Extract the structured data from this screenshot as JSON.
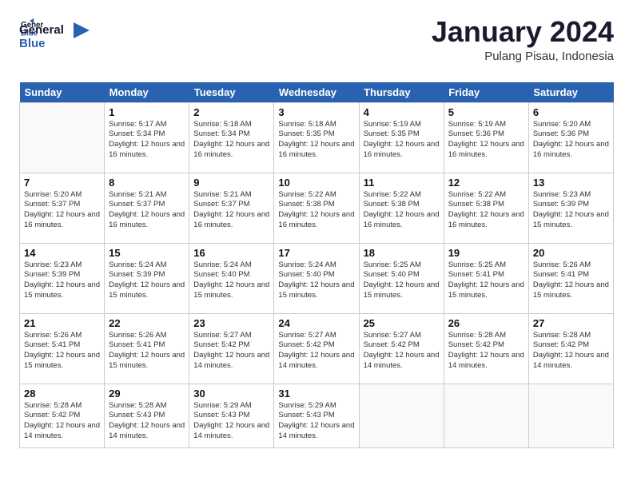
{
  "logo": {
    "line1": "General",
    "line2": "Blue"
  },
  "title": "January 2024",
  "subtitle": "Pulang Pisau, Indonesia",
  "days_header": [
    "Sunday",
    "Monday",
    "Tuesday",
    "Wednesday",
    "Thursday",
    "Friday",
    "Saturday"
  ],
  "weeks": [
    [
      {
        "day": "",
        "info": ""
      },
      {
        "day": "1",
        "info": "Sunrise: 5:17 AM\nSunset: 5:34 PM\nDaylight: 12 hours and 16 minutes."
      },
      {
        "day": "2",
        "info": "Sunrise: 5:18 AM\nSunset: 5:34 PM\nDaylight: 12 hours and 16 minutes."
      },
      {
        "day": "3",
        "info": "Sunrise: 5:18 AM\nSunset: 5:35 PM\nDaylight: 12 hours and 16 minutes."
      },
      {
        "day": "4",
        "info": "Sunrise: 5:19 AM\nSunset: 5:35 PM\nDaylight: 12 hours and 16 minutes."
      },
      {
        "day": "5",
        "info": "Sunrise: 5:19 AM\nSunset: 5:36 PM\nDaylight: 12 hours and 16 minutes."
      },
      {
        "day": "6",
        "info": "Sunrise: 5:20 AM\nSunset: 5:36 PM\nDaylight: 12 hours and 16 minutes."
      }
    ],
    [
      {
        "day": "7",
        "info": "Sunrise: 5:20 AM\nSunset: 5:37 PM\nDaylight: 12 hours and 16 minutes."
      },
      {
        "day": "8",
        "info": "Sunrise: 5:21 AM\nSunset: 5:37 PM\nDaylight: 12 hours and 16 minutes."
      },
      {
        "day": "9",
        "info": "Sunrise: 5:21 AM\nSunset: 5:37 PM\nDaylight: 12 hours and 16 minutes."
      },
      {
        "day": "10",
        "info": "Sunrise: 5:22 AM\nSunset: 5:38 PM\nDaylight: 12 hours and 16 minutes."
      },
      {
        "day": "11",
        "info": "Sunrise: 5:22 AM\nSunset: 5:38 PM\nDaylight: 12 hours and 16 minutes."
      },
      {
        "day": "12",
        "info": "Sunrise: 5:22 AM\nSunset: 5:38 PM\nDaylight: 12 hours and 16 minutes."
      },
      {
        "day": "13",
        "info": "Sunrise: 5:23 AM\nSunset: 5:39 PM\nDaylight: 12 hours and 15 minutes."
      }
    ],
    [
      {
        "day": "14",
        "info": "Sunrise: 5:23 AM\nSunset: 5:39 PM\nDaylight: 12 hours and 15 minutes."
      },
      {
        "day": "15",
        "info": "Sunrise: 5:24 AM\nSunset: 5:39 PM\nDaylight: 12 hours and 15 minutes."
      },
      {
        "day": "16",
        "info": "Sunrise: 5:24 AM\nSunset: 5:40 PM\nDaylight: 12 hours and 15 minutes."
      },
      {
        "day": "17",
        "info": "Sunrise: 5:24 AM\nSunset: 5:40 PM\nDaylight: 12 hours and 15 minutes."
      },
      {
        "day": "18",
        "info": "Sunrise: 5:25 AM\nSunset: 5:40 PM\nDaylight: 12 hours and 15 minutes."
      },
      {
        "day": "19",
        "info": "Sunrise: 5:25 AM\nSunset: 5:41 PM\nDaylight: 12 hours and 15 minutes."
      },
      {
        "day": "20",
        "info": "Sunrise: 5:26 AM\nSunset: 5:41 PM\nDaylight: 12 hours and 15 minutes."
      }
    ],
    [
      {
        "day": "21",
        "info": "Sunrise: 5:26 AM\nSunset: 5:41 PM\nDaylight: 12 hours and 15 minutes."
      },
      {
        "day": "22",
        "info": "Sunrise: 5:26 AM\nSunset: 5:41 PM\nDaylight: 12 hours and 15 minutes."
      },
      {
        "day": "23",
        "info": "Sunrise: 5:27 AM\nSunset: 5:42 PM\nDaylight: 12 hours and 14 minutes."
      },
      {
        "day": "24",
        "info": "Sunrise: 5:27 AM\nSunset: 5:42 PM\nDaylight: 12 hours and 14 minutes."
      },
      {
        "day": "25",
        "info": "Sunrise: 5:27 AM\nSunset: 5:42 PM\nDaylight: 12 hours and 14 minutes."
      },
      {
        "day": "26",
        "info": "Sunrise: 5:28 AM\nSunset: 5:42 PM\nDaylight: 12 hours and 14 minutes."
      },
      {
        "day": "27",
        "info": "Sunrise: 5:28 AM\nSunset: 5:42 PM\nDaylight: 12 hours and 14 minutes."
      }
    ],
    [
      {
        "day": "28",
        "info": "Sunrise: 5:28 AM\nSunset: 5:42 PM\nDaylight: 12 hours and 14 minutes."
      },
      {
        "day": "29",
        "info": "Sunrise: 5:28 AM\nSunset: 5:43 PM\nDaylight: 12 hours and 14 minutes."
      },
      {
        "day": "30",
        "info": "Sunrise: 5:29 AM\nSunset: 5:43 PM\nDaylight: 12 hours and 14 minutes."
      },
      {
        "day": "31",
        "info": "Sunrise: 5:29 AM\nSunset: 5:43 PM\nDaylight: 12 hours and 14 minutes."
      },
      {
        "day": "",
        "info": ""
      },
      {
        "day": "",
        "info": ""
      },
      {
        "day": "",
        "info": ""
      }
    ]
  ]
}
